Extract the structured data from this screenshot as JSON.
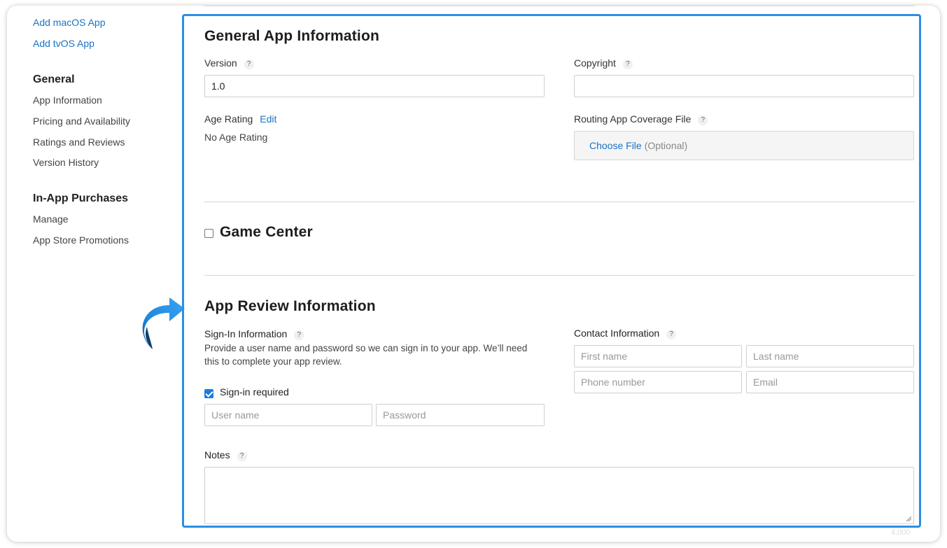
{
  "sidebar": {
    "links": [
      {
        "label": "Add macOS App"
      },
      {
        "label": "Add tvOS App"
      }
    ],
    "sections": [
      {
        "heading": "General",
        "items": [
          {
            "label": "App Information"
          },
          {
            "label": "Pricing and Availability"
          },
          {
            "label": "Ratings and Reviews"
          },
          {
            "label": "Version History"
          }
        ]
      },
      {
        "heading": "In-App Purchases",
        "items": [
          {
            "label": "Manage"
          },
          {
            "label": "App Store Promotions"
          }
        ]
      }
    ],
    "arrow_icon": "curved-arrow-right-icon"
  },
  "general": {
    "title": "General App Information",
    "version_label": "Version",
    "version_value": "1.0",
    "copyright_label": "Copyright",
    "copyright_value": "",
    "age_rating_label": "Age Rating",
    "age_rating_edit": "Edit",
    "age_rating_value": "No Age Rating",
    "routing_label": "Routing App Coverage File",
    "choose_file": "Choose File",
    "optional": "(Optional)",
    "help_glyph": "?"
  },
  "game_center": {
    "title": "Game Center",
    "checked": false
  },
  "review": {
    "title": "App Review Information",
    "signin_label": "Sign-In Information",
    "signin_desc": "Provide a user name and password so we can sign in to your app. We’ll need this to complete your app review.",
    "signin_required_label": "Sign-in required",
    "signin_required_checked": true,
    "username_placeholder": "User name",
    "password_placeholder": "Password",
    "contact_label": "Contact Information",
    "first_name_placeholder": "First name",
    "last_name_placeholder": "Last name",
    "phone_placeholder": "Phone number",
    "email_placeholder": "Email",
    "notes_label": "Notes",
    "notes_counter": "4,000"
  },
  "colors": {
    "accent": "#1a73c4",
    "highlight_frame": "#2b8ee6",
    "checkbox_checked": "#1a7be0"
  }
}
